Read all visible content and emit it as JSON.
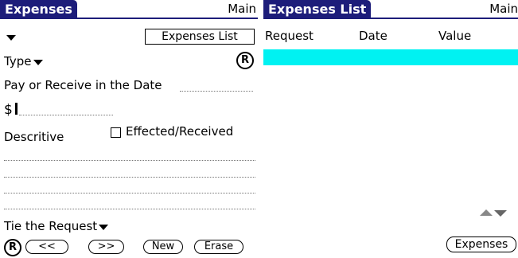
{
  "left": {
    "title": "Expenses",
    "menu": "Main",
    "expenses_list_button": "Expenses List",
    "type_label": "Type",
    "pay_label": "Pay or Receive in the Date",
    "currency": "$",
    "descriptive_label": "Descritive",
    "effected_label": "Effected/Received",
    "effected_checked": false,
    "tie_label": "Tie the Request",
    "registered_logo": "R",
    "prev_button": "<<",
    "next_button": ">>",
    "new_button": "New",
    "erase_button": "Erase"
  },
  "right": {
    "title": "Expenses List",
    "menu": "Main",
    "columns": [
      "Request",
      "Date",
      "Value"
    ],
    "rows": [],
    "expenses_button": "Expenses",
    "highlight_color": "#00f2f2"
  }
}
